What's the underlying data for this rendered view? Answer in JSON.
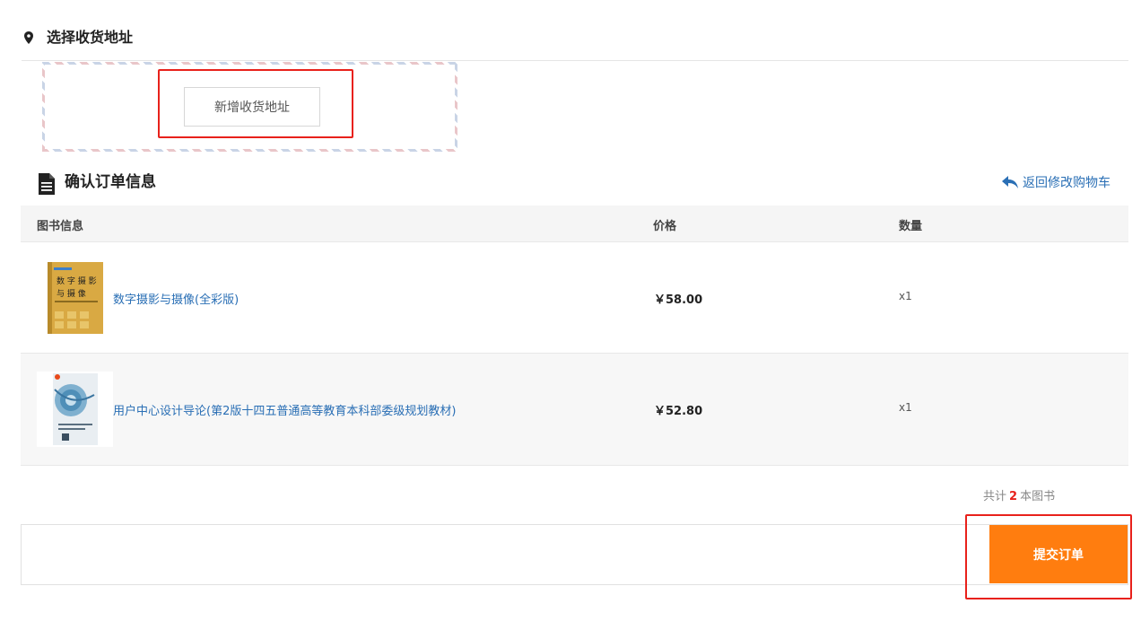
{
  "address": {
    "title": "选择收货地址",
    "add_button_label": "新增收货地址"
  },
  "order": {
    "title": "确认订单信息",
    "back_link": "返回修改购物车",
    "columns": {
      "book": "图书信息",
      "price": "价格",
      "qty": "数量"
    },
    "items": [
      {
        "name": "数字摄影与摄像(全彩版)",
        "price": "￥58.00",
        "qty": "x1",
        "cover_text": "数 字 摄 影 与 摄 像"
      },
      {
        "name": "用户中心设计导论(第2版十四五普通高等教育本科部委级规划教材)",
        "price": "￥52.80",
        "qty": "x1"
      }
    ]
  },
  "summary": {
    "prefix": "共计",
    "count": "2",
    "suffix": "本图书"
  },
  "submit": {
    "label": "提交订单"
  },
  "colors": {
    "accent": "#ff7d0f",
    "link": "#2a6fb5",
    "highlight": "#e8211b"
  }
}
